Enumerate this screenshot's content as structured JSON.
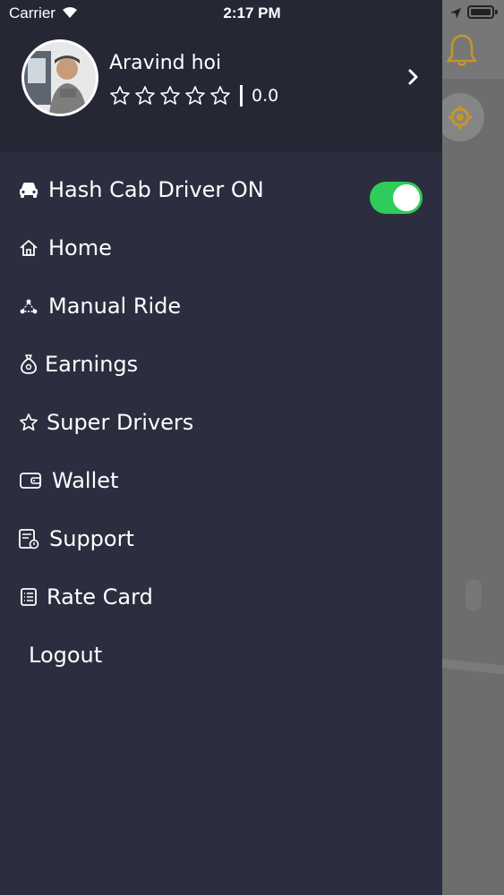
{
  "status_bar": {
    "carrier": "Carrier",
    "time": "2:17 PM"
  },
  "user": {
    "name": "Aravind hoi",
    "rating": "0.0",
    "stars": 5
  },
  "menu": [
    {
      "label": "Hash Cab Driver ON",
      "icon": "car-icon",
      "toggle_on": true
    },
    {
      "label": "Home",
      "icon": "home-icon"
    },
    {
      "label": "Manual Ride",
      "icon": "route-icon"
    },
    {
      "label": "Earnings",
      "icon": "money-bag-icon"
    },
    {
      "label": "Super Drivers",
      "icon": "star-icon"
    },
    {
      "label": "Wallet",
      "icon": "wallet-icon"
    },
    {
      "label": "Support",
      "icon": "support-icon"
    },
    {
      "label": "Rate Card",
      "icon": "list-icon"
    },
    {
      "label": "Logout",
      "icon": ""
    }
  ],
  "colors": {
    "drawer": "#2c2e3f",
    "header": "#252735",
    "toggle": "#2ecc5a",
    "accent": "#d9a31d"
  }
}
